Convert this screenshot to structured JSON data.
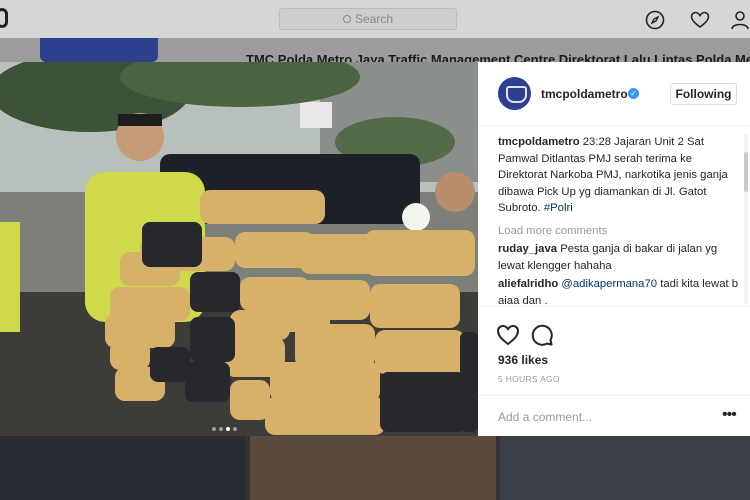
{
  "background": {
    "search_placeholder": "Search",
    "profile_title": "TMC Polda Metro Jaya Traffic Management Centre Direktorat Lalu Lintas Polda Metro"
  },
  "post": {
    "username": "tmcpoldametro",
    "verified": true,
    "follow_label": "Following",
    "caption": {
      "author": "tmcpoldametro",
      "text": "23:28 Jajaran Unit 2 Sat Pamwal Ditlantas PMJ serah terima ke Direktorat Narkoba PMJ, narkotika jenis ganja dibawa Pick Up yg diamankan di Jl. Gatot Subroto.",
      "hashtag": "#Polri"
    },
    "load_more_label": "Load more comments",
    "comments": [
      {
        "author": "ruday_java",
        "text": "Pesta ganja di bakar di jalan yg lewat klengger hahaha"
      },
      {
        "author": "aliefalridho",
        "mention": "@adikapermana70",
        "text": "tadi kita lewat b ajaa dan ."
      }
    ],
    "likes": "936 likes",
    "timestamp": "5 HOURS AGO",
    "add_comment_placeholder": "Add a comment...",
    "more_options": "•••",
    "carousel": {
      "count": 4,
      "active_index": 2
    }
  },
  "colors": {
    "brand_blue": "#2d3f8f",
    "verified_blue": "#3897f0",
    "link": "#003569",
    "muted": "#999999"
  },
  "icons": [
    "search-icon",
    "compass-icon",
    "heart-icon",
    "profile-icon",
    "verified-icon",
    "like-icon",
    "comment-icon",
    "more-icon"
  ]
}
